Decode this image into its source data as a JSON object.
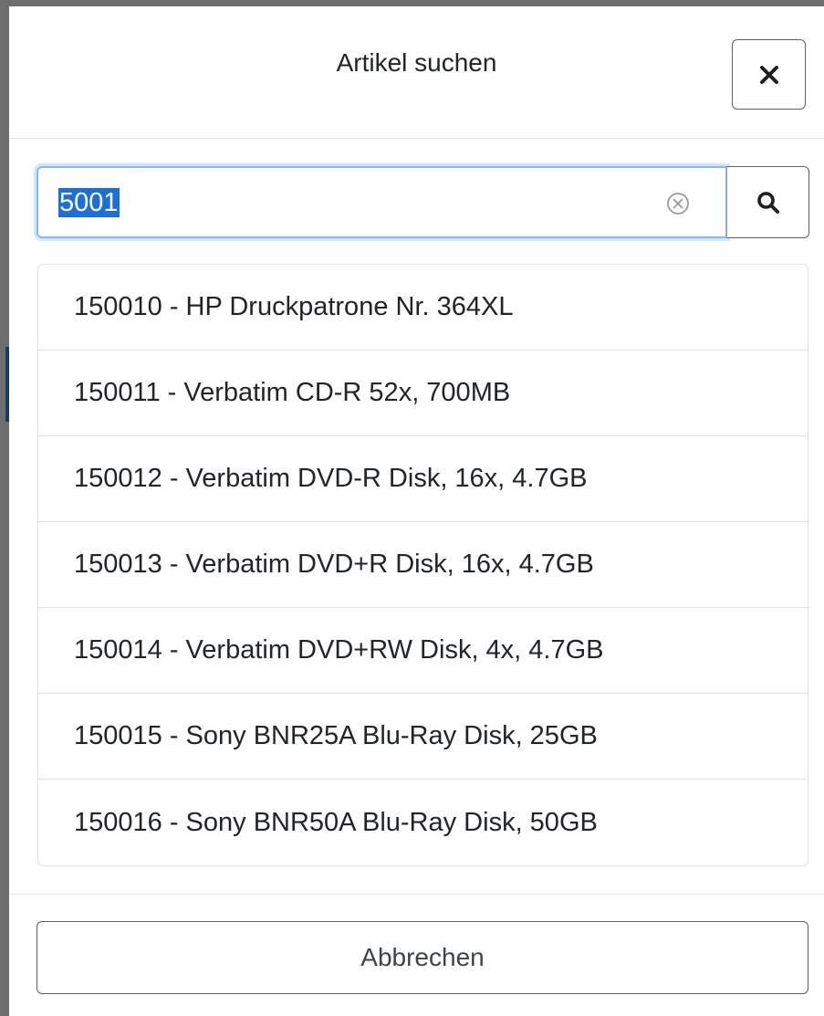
{
  "dialog": {
    "title": "Artikel suchen",
    "close_icon": "close-icon"
  },
  "search": {
    "value": "5001",
    "clear_icon": "clear-circle-icon",
    "button_icon": "search-icon"
  },
  "results": [
    {
      "label": "150010 - HP Druckpatrone Nr. 364XL"
    },
    {
      "label": "150011 - Verbatim CD-R 52x, 700MB"
    },
    {
      "label": "150012 - Verbatim DVD-R Disk, 16x, 4.7GB"
    },
    {
      "label": "150013 - Verbatim DVD+R Disk, 16x, 4.7GB"
    },
    {
      "label": "150014 - Verbatim DVD+RW Disk, 4x, 4.7GB"
    },
    {
      "label": "150015 - Sony BNR25A Blu-Ray Disk, 25GB"
    },
    {
      "label": "150016 - Sony BNR50A Blu-Ray Disk, 50GB"
    }
  ],
  "footer": {
    "cancel_label": "Abbrechen"
  },
  "colors": {
    "selection": "#1b6fd6",
    "focus_border": "#86b7fe",
    "border": "#dfe2e6",
    "text": "#212529"
  }
}
